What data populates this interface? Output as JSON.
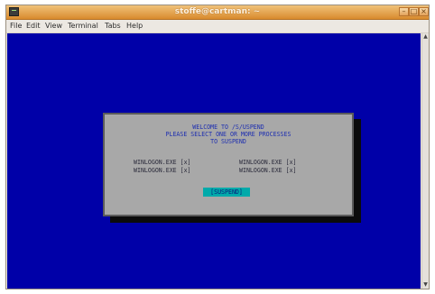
{
  "window": {
    "title": "stoffe@cartman: ~",
    "controls": {
      "minimize": "–",
      "maximize": "□",
      "close": "×"
    }
  },
  "menubar": {
    "items": [
      "File",
      "Edit",
      "View",
      "Terminal",
      "Tabs",
      "Help"
    ]
  },
  "scrollbar": {
    "up_arrow": "▲",
    "down_arrow": "▼"
  },
  "dialog": {
    "line1": "WELCOME TO /S/USPEND",
    "line2": "PLEASE SELECT ONE OR MORE PROCESSES",
    "line3": "TO SUSPEND",
    "options": [
      "WINLOGON.EXE [x]",
      "WINLOGON.EXE [x]",
      "WINLOGON.EXE [x]",
      "WINLOGON.EXE [x]"
    ],
    "button_label": "[SUSPEND]"
  },
  "colors": {
    "terminal_bg": "#0000a8",
    "dialog_bg": "#a8a8a8",
    "button_bg": "#00aaaa",
    "titlebar": "#e3a25a"
  }
}
